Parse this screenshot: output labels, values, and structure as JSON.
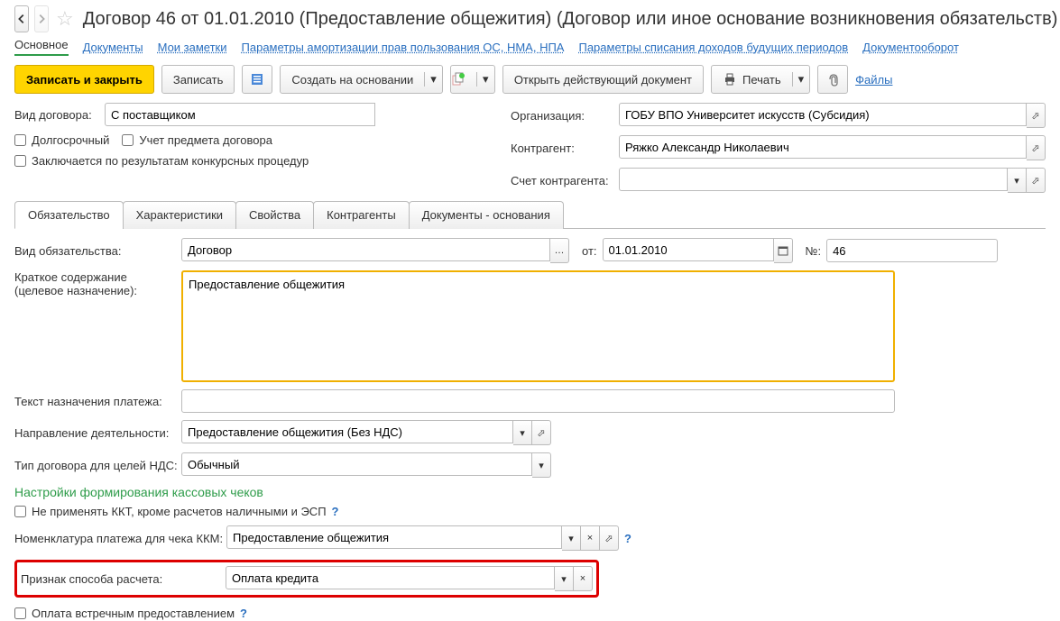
{
  "header": {
    "title": "Договор 46 от 01.01.2010 (Предоставление общежития) (Договор или иное основание возникновения обязательств)"
  },
  "nav": {
    "main": "Основное",
    "documents": "Документы",
    "notes": "Мои заметки",
    "amort": "Параметры амортизации прав пользования ОС, НМА, НПА",
    "writeoff": "Параметры списания доходов будущих периодов",
    "docflow": "Документооборот"
  },
  "toolbar": {
    "save_close": "Записать и закрыть",
    "save": "Записать",
    "create_based": "Создать на основании",
    "open_active": "Открыть действующий документ",
    "print": "Печать",
    "files": "Файлы"
  },
  "fields": {
    "contract_type_lbl": "Вид договора:",
    "contract_type_val": "С поставщиком",
    "longterm": "Долгосрочный",
    "track_subject": "Учет предмета договора",
    "tender": "Заключается по результатам конкурсных процедур",
    "org_lbl": "Организация:",
    "org_val": "ГОБУ ВПО Университет искусств (Субсидия)",
    "counter_lbl": "Контрагент:",
    "counter_val": "Ряжко Александр Николаевич",
    "account_lbl": "Счет контрагента:",
    "account_val": ""
  },
  "tabs": {
    "t1": "Обязательство",
    "t2": "Характеристики",
    "t3": "Свойства",
    "t4": "Контрагенты",
    "t5": "Документы - основания"
  },
  "obl": {
    "type_lbl": "Вид обязательства:",
    "type_val": "Договор",
    "from_lbl": "от:",
    "from_val": "01.01.2010",
    "num_lbl": "№:",
    "num_val": "46",
    "brief_lbl1": "Краткое содержание",
    "brief_lbl2": "(целевое назначение):",
    "brief_val": "Предоставление общежития",
    "payment_text_lbl": "Текст назначения платежа:",
    "payment_text_val": "",
    "direction_lbl": "Направление деятельности:",
    "direction_val": "Предоставление общежития (Без НДС)",
    "vat_type_lbl": "Тип договора для целей НДС:",
    "vat_type_val": "Обычный",
    "section_title": "Настройки формирования кассовых чеков",
    "no_kkt": "Не применять ККТ, кроме расчетов наличными и ЭСП",
    "nomen_lbl": "Номенклатура платежа для чека ККМ:",
    "nomen_val": "Предоставление общежития",
    "calc_method_lbl": "Признак способа расчета:",
    "calc_method_val": "Оплата кредита",
    "counter_pay": "Оплата встречным предоставлением"
  }
}
